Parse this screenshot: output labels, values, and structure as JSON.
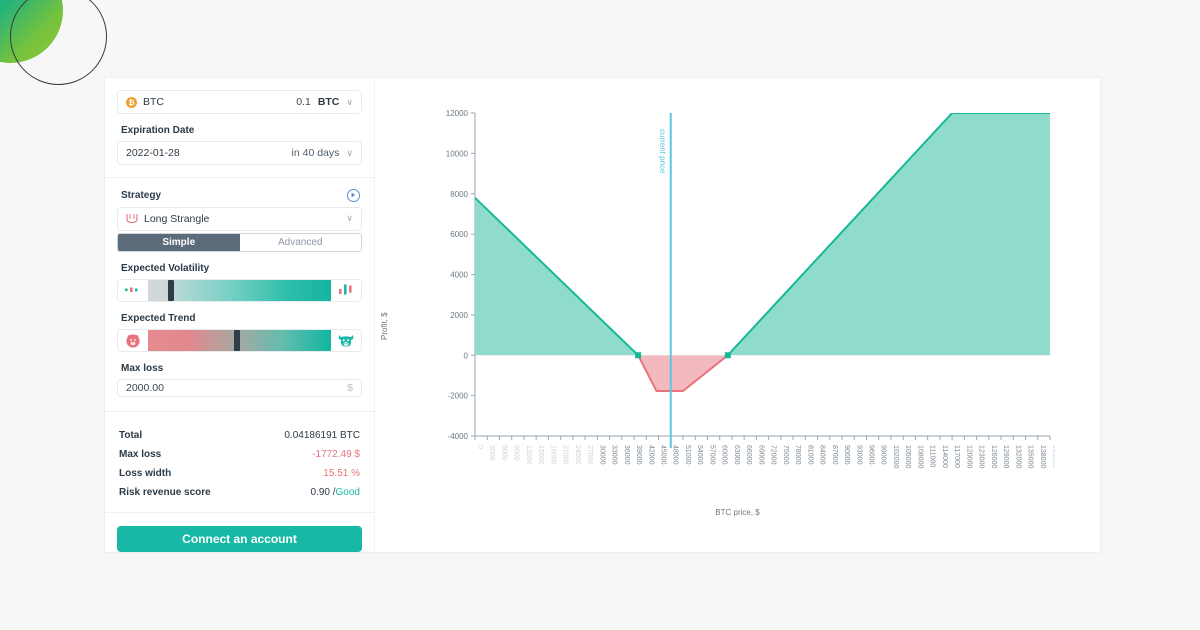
{
  "sidebar": {
    "asset": {
      "icon": "btc-coin-icon",
      "symbol": "BTC",
      "amount": "0.1",
      "unit": "BTC",
      "chevron": "∨"
    },
    "expiration": {
      "label": "Expiration Date",
      "date": "2022-01-28",
      "relative": "in 40 days",
      "chevron": "∨"
    },
    "strategy": {
      "label": "Strategy",
      "info_icon": "play-circle-icon",
      "name": "Long Strangle",
      "glyph": "long-strangle-icon",
      "chevron": "∨"
    },
    "mode_tabs": [
      {
        "label": "Simple",
        "active": true
      },
      {
        "label": "Advanced",
        "active": false
      }
    ],
    "volatility": {
      "label": "Expected Volatility",
      "left_icon": "low-volatility-candles-icon",
      "right_icon": "high-volatility-candles-icon",
      "handle_percent": 11
    },
    "trend": {
      "label": "Expected Trend",
      "left_icon": "bear-icon",
      "right_icon": "bull-icon",
      "handle_percent": 47
    },
    "max_loss_input": {
      "label": "Max loss",
      "value": "2000.00",
      "suffix": "$"
    },
    "stats": [
      {
        "key": "Total",
        "value": "0.04186191 BTC",
        "style": "plain"
      },
      {
        "key": "Max loss",
        "value": "-1772.49 $",
        "style": "negative"
      },
      {
        "key": "Loss width",
        "value": "15.51 %",
        "style": "negative"
      },
      {
        "key": "Risk revenue score",
        "value": "0.90 /",
        "suffix": "Good",
        "style": "score"
      }
    ],
    "connect_button": "Connect an account"
  },
  "colors": {
    "accent_teal": "#17b8a6",
    "area_teal": "#8fdccd",
    "profit_line": "#16b897",
    "loss_fill": "#f4b9bf",
    "loss_line": "#e8737d",
    "current_price_line": "#5fc6dd",
    "btc_orange": "#f0a030",
    "tab_active_bg": "#5c6b7a"
  },
  "chart_data": {
    "type": "line",
    "title": "",
    "xlabel": "BTC price, $",
    "ylabel": "Profit, $",
    "xlim": [
      0,
      141000
    ],
    "ylim": [
      -4000,
      12000
    ],
    "xtick_step": 3000,
    "ytick_step": 2000,
    "yticks": [
      -4000,
      -2000,
      0,
      2000,
      4000,
      6000,
      8000,
      10000,
      12000
    ],
    "xticks": [
      0,
      3000,
      6000,
      9000,
      12000,
      15000,
      18000,
      21000,
      24000,
      27000,
      30000,
      33000,
      36000,
      39000,
      42000,
      45000,
      48000,
      51000,
      54000,
      57000,
      60000,
      63000,
      66000,
      69000,
      72000,
      75000,
      78000,
      81000,
      84000,
      87000,
      90000,
      93000,
      96000,
      99000,
      102000,
      105000,
      108000,
      111000,
      114000,
      117000,
      120000,
      123000,
      126000,
      129000,
      132000,
      135000,
      138000,
      141000
    ],
    "faded_xticks": [
      0,
      3000,
      6000,
      9000,
      12000,
      15000,
      18000,
      21000,
      24000,
      27000,
      141000
    ],
    "grid": false,
    "legend": null,
    "annotations": [
      {
        "text": "current price",
        "x": 48000,
        "orientation": "vertical",
        "color": "#5fc6dd"
      }
    ],
    "series": [
      {
        "name": "Profit",
        "points": [
          {
            "x": 0,
            "y": 7800
          },
          {
            "x": 40000,
            "y": 0
          },
          {
            "x": 44500,
            "y": -1772
          },
          {
            "x": 51000,
            "y": -1772
          },
          {
            "x": 62000,
            "y": 0
          },
          {
            "x": 117000,
            "y": 12000
          },
          {
            "x": 141000,
            "y": 12000
          }
        ],
        "breakeven_low": 40000,
        "breakeven_high": 62000,
        "max_loss": -1772.49,
        "max_profit_cap": 12000
      }
    ]
  }
}
